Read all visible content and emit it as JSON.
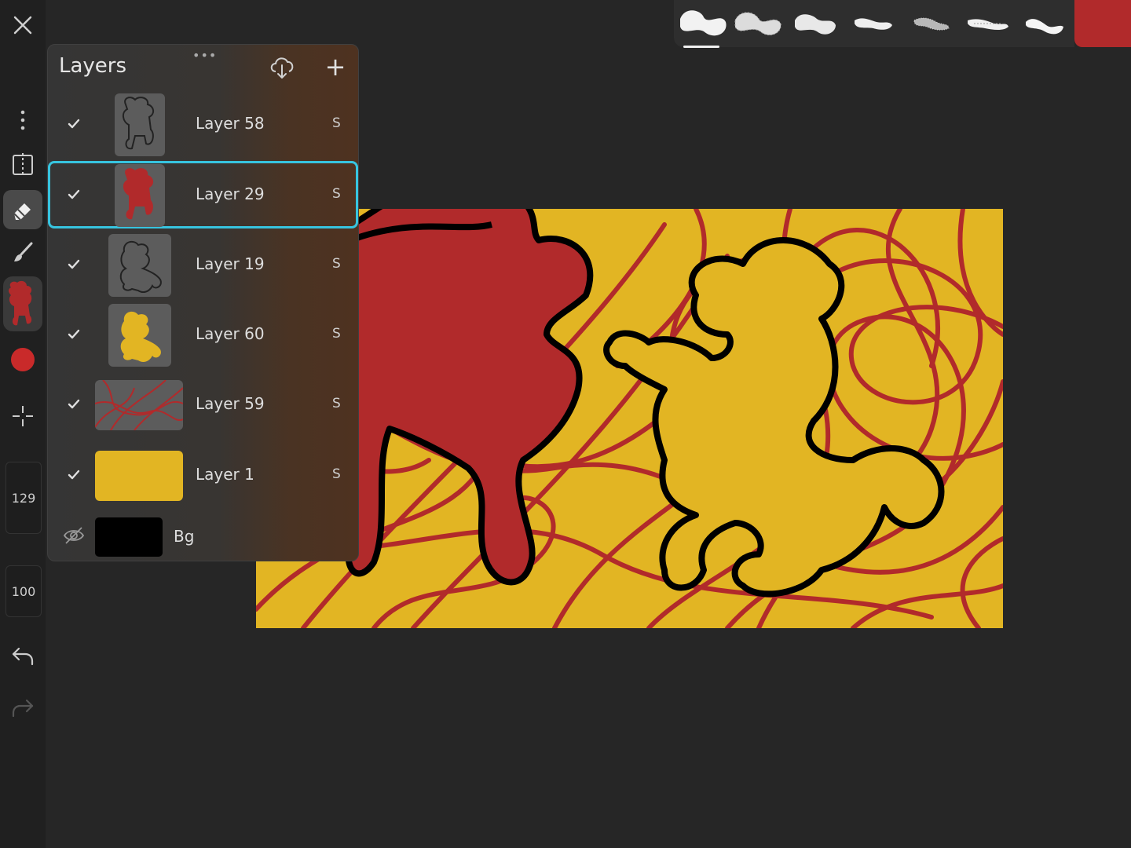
{
  "layers_panel": {
    "title": "Layers",
    "grip": "•••",
    "add_label": "+",
    "layers": [
      {
        "name": "Layer 58",
        "mode": "S",
        "visible": true,
        "selected": false,
        "thumb": "gray-outline"
      },
      {
        "name": "Layer 29",
        "mode": "S",
        "visible": true,
        "selected": true,
        "thumb": "red-poodle"
      },
      {
        "name": "Layer 19",
        "mode": "S",
        "visible": true,
        "selected": false,
        "thumb": "gray-outline"
      },
      {
        "name": "Layer 60",
        "mode": "S",
        "visible": true,
        "selected": false,
        "thumb": "yellow-poodle"
      },
      {
        "name": "Layer 59",
        "mode": "S",
        "visible": true,
        "selected": false,
        "thumb": "red-scribble"
      },
      {
        "name": "Layer 1",
        "mode": "S",
        "visible": true,
        "selected": false,
        "thumb": "yellow-fill"
      }
    ],
    "background": {
      "name": "Bg",
      "visible": false
    }
  },
  "toolbar": {
    "brush_size": "129",
    "opacity": "100"
  },
  "colors": {
    "current": "#b12a2b",
    "canvas_yellow": "#e2b523",
    "scribble_red": "#b12a2b",
    "selection": "#37c4df"
  }
}
